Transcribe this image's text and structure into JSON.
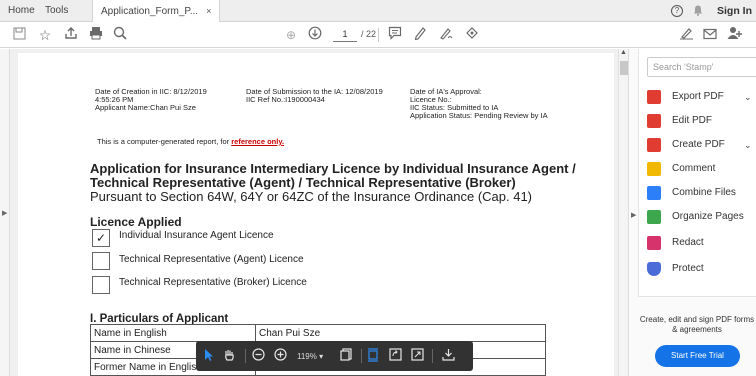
{
  "tabs": {
    "home": "Home",
    "tools": "Tools",
    "document": "Application_Form_P...",
    "close": "×"
  },
  "header_right": {
    "help": "?",
    "bell": "🔔",
    "signin": "Sign In"
  },
  "toolbar": {
    "page_current": "1",
    "page_total": "/ 22"
  },
  "doc": {
    "creation": "Date of Creation in IIC: 8/12/2019",
    "creation_time": "4:55:26 PM",
    "applicant_name": "Applicant Name:Chan Pui Sze",
    "submission": "Date of Submission to the IA: 12/08/2019",
    "iic_ref": "IIC Ref No.:I190000434",
    "approval": "Date of IA's Approval:",
    "licence_no": "Licence No.:",
    "iic_status": "IIC Status: Submitted to IA",
    "app_status": "Application Status: Pending Review by IA",
    "generated_prefix": "This is a computer-generated report, for ",
    "generated_link": "reference only.",
    "title_line1": "Application for Insurance Intermediary Licence by Individual Insurance Agent /",
    "title_line2": "Technical Representative (Agent) / Technical Representative (Broker)",
    "subtitle": "Pursuant to Section 64W, 64Y or 64ZC of the Insurance Ordinance (Cap. 41)",
    "licence_heading": "Licence Applied",
    "licences": [
      {
        "label": "Individual Insurance Agent Licence",
        "checked": "✓"
      },
      {
        "label": "Technical Representative (Agent) Licence",
        "checked": ""
      },
      {
        "label": "Technical Representative (Broker) Licence",
        "checked": ""
      }
    ],
    "particulars_heading": "I. Particulars of Applicant",
    "rows": [
      {
        "label": "Name in English",
        "value": "Chan Pui Sze"
      },
      {
        "label": "Name in Chinese",
        "value": ""
      },
      {
        "label": "Former Name in English",
        "value": ""
      }
    ]
  },
  "float": {
    "zoom": "119%"
  },
  "right_panel": {
    "search_placeholder": "Search 'Stamp'",
    "tools": [
      {
        "label": "Export PDF",
        "color": "#e03c31",
        "chev": "⌄"
      },
      {
        "label": "Edit PDF",
        "color": "#e03c31",
        "chev": ""
      },
      {
        "label": "Create PDF",
        "color": "#e03c31",
        "chev": "⌄"
      },
      {
        "label": "Comment",
        "color": "#f0b800",
        "chev": ""
      },
      {
        "label": "Combine Files",
        "color": "#2d7ff9",
        "chev": ""
      },
      {
        "label": "Organize Pages",
        "color": "#3da74e",
        "chev": ""
      },
      {
        "label": "Redact",
        "color": "#d6336c",
        "chev": ""
      },
      {
        "label": "Protect",
        "color": "#4b6cd8",
        "chev": ""
      }
    ],
    "promo_text": "Create, edit and sign PDF forms & agreements",
    "trial_button": "Start Free Trial"
  },
  "colors": {
    "accent": "#1473e6",
    "link": "#cc0000"
  }
}
